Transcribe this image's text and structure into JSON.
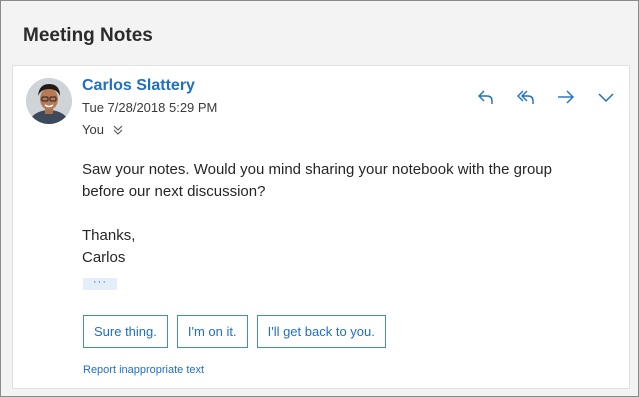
{
  "email": {
    "subject": "Meeting Notes",
    "sender_name": "Carlos Slattery",
    "datetime": "Tue 7/28/2018 5:29 PM",
    "to": "You",
    "body": {
      "line1": "Saw your notes. Would you mind sharing your notebook with the group",
      "line2": "before our next discussion?",
      "signoff": "Thanks,",
      "signature": "Carlos"
    },
    "expand_label": "···"
  },
  "actions": {
    "icons": [
      "reply-icon",
      "reply-all-icon",
      "forward-icon",
      "more-chevron-icon"
    ]
  },
  "smart_replies": [
    "Sure thing.",
    "I'm on it.",
    "I'll get back to you."
  ],
  "report_link": "Report inappropriate text",
  "colors": {
    "accent": "#1f6fc2",
    "background": "#f3f3f3",
    "card": "#ffffff"
  }
}
